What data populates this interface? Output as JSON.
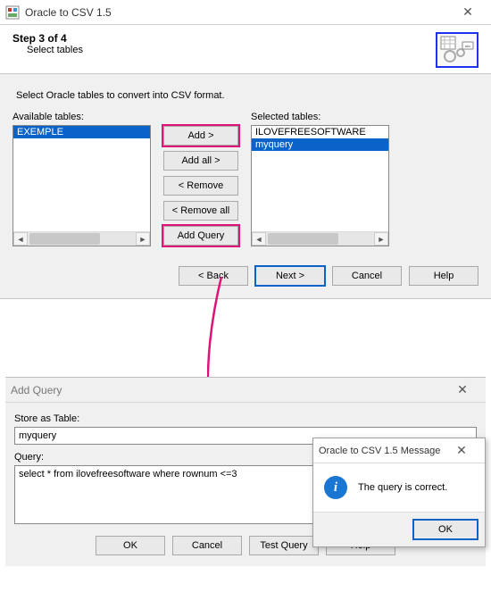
{
  "window1": {
    "title": "Oracle to CSV 1.5",
    "step_title": "Step 3 of 4",
    "step_subtitle": "Select tables",
    "instruction": "Select Oracle tables to convert into CSV format.",
    "available_label": "Available tables:",
    "available_items": [
      "EXEMPLE"
    ],
    "selected_label": "Selected tables:",
    "selected_items": [
      "ILOVEFREESOFTWARE",
      "myquery"
    ],
    "btn_add": "Add >",
    "btn_add_all": "Add all >",
    "btn_remove": "< Remove",
    "btn_remove_all": "< Remove all",
    "btn_add_query": "Add Query",
    "nav_back": "< Back",
    "nav_next": "Next >",
    "nav_cancel": "Cancel",
    "nav_help": "Help"
  },
  "window2": {
    "title": "Add Query",
    "store_label": "Store as Table:",
    "store_value": "myquery",
    "query_label": "Query:",
    "query_value": "select * from ilovefreesoftware where rownum <=3",
    "btn_ok": "OK",
    "btn_cancel": "Cancel",
    "btn_test": "Test Query",
    "btn_help": "Help"
  },
  "msgbox": {
    "title": "Oracle to CSV 1.5  Message",
    "text": "The query is correct.",
    "btn_ok": "OK"
  }
}
